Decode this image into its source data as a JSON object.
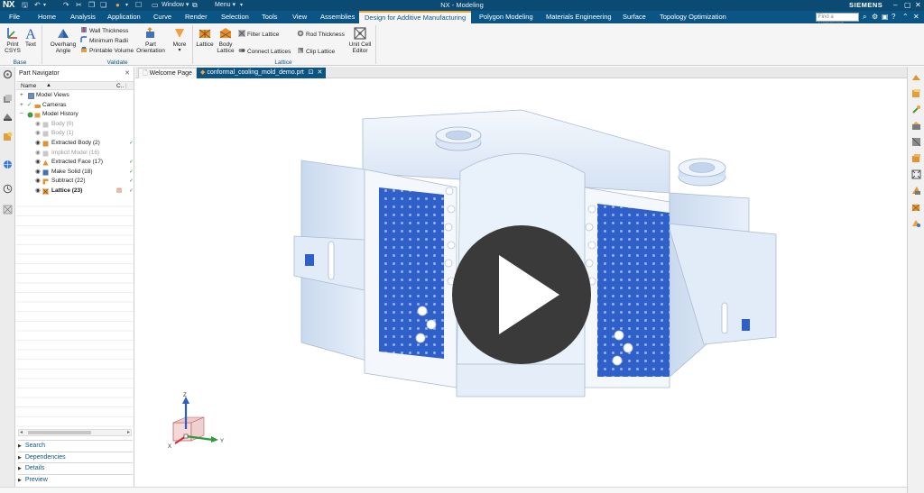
{
  "titlebar": {
    "logo": "NX",
    "window_menu": "Window ▾",
    "menu_menu": "Menu ▾",
    "title": "NX - Modeling",
    "brand": "SIEMENS"
  },
  "tabs": [
    {
      "label": "File"
    },
    {
      "label": "Home"
    },
    {
      "label": "Analysis"
    },
    {
      "label": "Application"
    },
    {
      "label": "Curve"
    },
    {
      "label": "Render"
    },
    {
      "label": "Selection"
    },
    {
      "label": "Tools"
    },
    {
      "label": "View"
    },
    {
      "label": "Assemblies"
    },
    {
      "label": "Design for Additive Manufacturing",
      "active": true
    },
    {
      "label": "Polygon Modeling"
    },
    {
      "label": "Materials Engineering"
    },
    {
      "label": "Surface"
    },
    {
      "label": "Topology Optimization"
    }
  ],
  "command_search": {
    "placeholder": "Find a Command"
  },
  "ribbon": {
    "base": {
      "print_csys": "Print CSYS",
      "text": "Text",
      "label": "Base"
    },
    "validate": {
      "overhang_angle": "Overhang Angle",
      "wall_thickness": "Wall Thickness",
      "minimum_radii": "Minimum Radii",
      "printable_volume": "Printable Volume",
      "part_orientation": "Part Orientation",
      "more": "More",
      "label": "Validate"
    },
    "lattice": {
      "lattice": "Lattice",
      "body_lattice": "Body Lattice",
      "filter_lattice": "Filter Lattice",
      "connect_lattices": "Connect Lattices",
      "rod_thickness": "Rod Thickness",
      "clip_lattice": "Clip Lattice",
      "unit_cell_editor": "Unit Cell Editor",
      "label": "Lattice"
    }
  },
  "navigator": {
    "title": "Part Navigator",
    "col_name": "Name",
    "col_c": "C..",
    "items": [
      {
        "label": "Model Views",
        "level": 0,
        "twisty": "+"
      },
      {
        "label": "Cameras",
        "level": 0,
        "twisty": "+"
      },
      {
        "label": "Model History",
        "level": 0,
        "twisty": "−"
      },
      {
        "label": "Body (0)",
        "level": 1,
        "grey": true
      },
      {
        "label": "Body (1)",
        "level": 1,
        "grey": true
      },
      {
        "label": "Extracted Body (2)",
        "level": 1
      },
      {
        "label": "Implicit Model (16)",
        "level": 1,
        "grey": true
      },
      {
        "label": "Extracted Face (17)",
        "level": 1
      },
      {
        "label": "Make Solid (18)",
        "level": 1
      },
      {
        "label": "Subtract (22)",
        "level": 1
      },
      {
        "label": "Lattice (23)",
        "level": 1,
        "bold": true
      }
    ],
    "panels": [
      "Search",
      "Dependencies",
      "Details",
      "Preview"
    ]
  },
  "doc_tabs": [
    {
      "label": "Welcome Page",
      "active": false
    },
    {
      "label": "conformal_cooling_mold_demo.prt",
      "active": true
    }
  ],
  "triad": {
    "x": "X",
    "y": "Y",
    "z": "Z"
  },
  "colors": {
    "titlebar": "#0a4a73",
    "tabbar": "#0b5584",
    "active_tab_accent": "#e8a33c",
    "part_body": "#dde9f7",
    "lattice_fill": "#2f5fc8",
    "play_overlay": "#3a3a3a"
  },
  "icons": [
    "save-icon",
    "undo-icon",
    "print-csys-icon",
    "text-icon",
    "overhang-angle-icon",
    "wall-thickness-icon",
    "lattice-icon",
    "unit-cell-editor-icon",
    "play-icon",
    "visibility-eye-icon"
  ]
}
